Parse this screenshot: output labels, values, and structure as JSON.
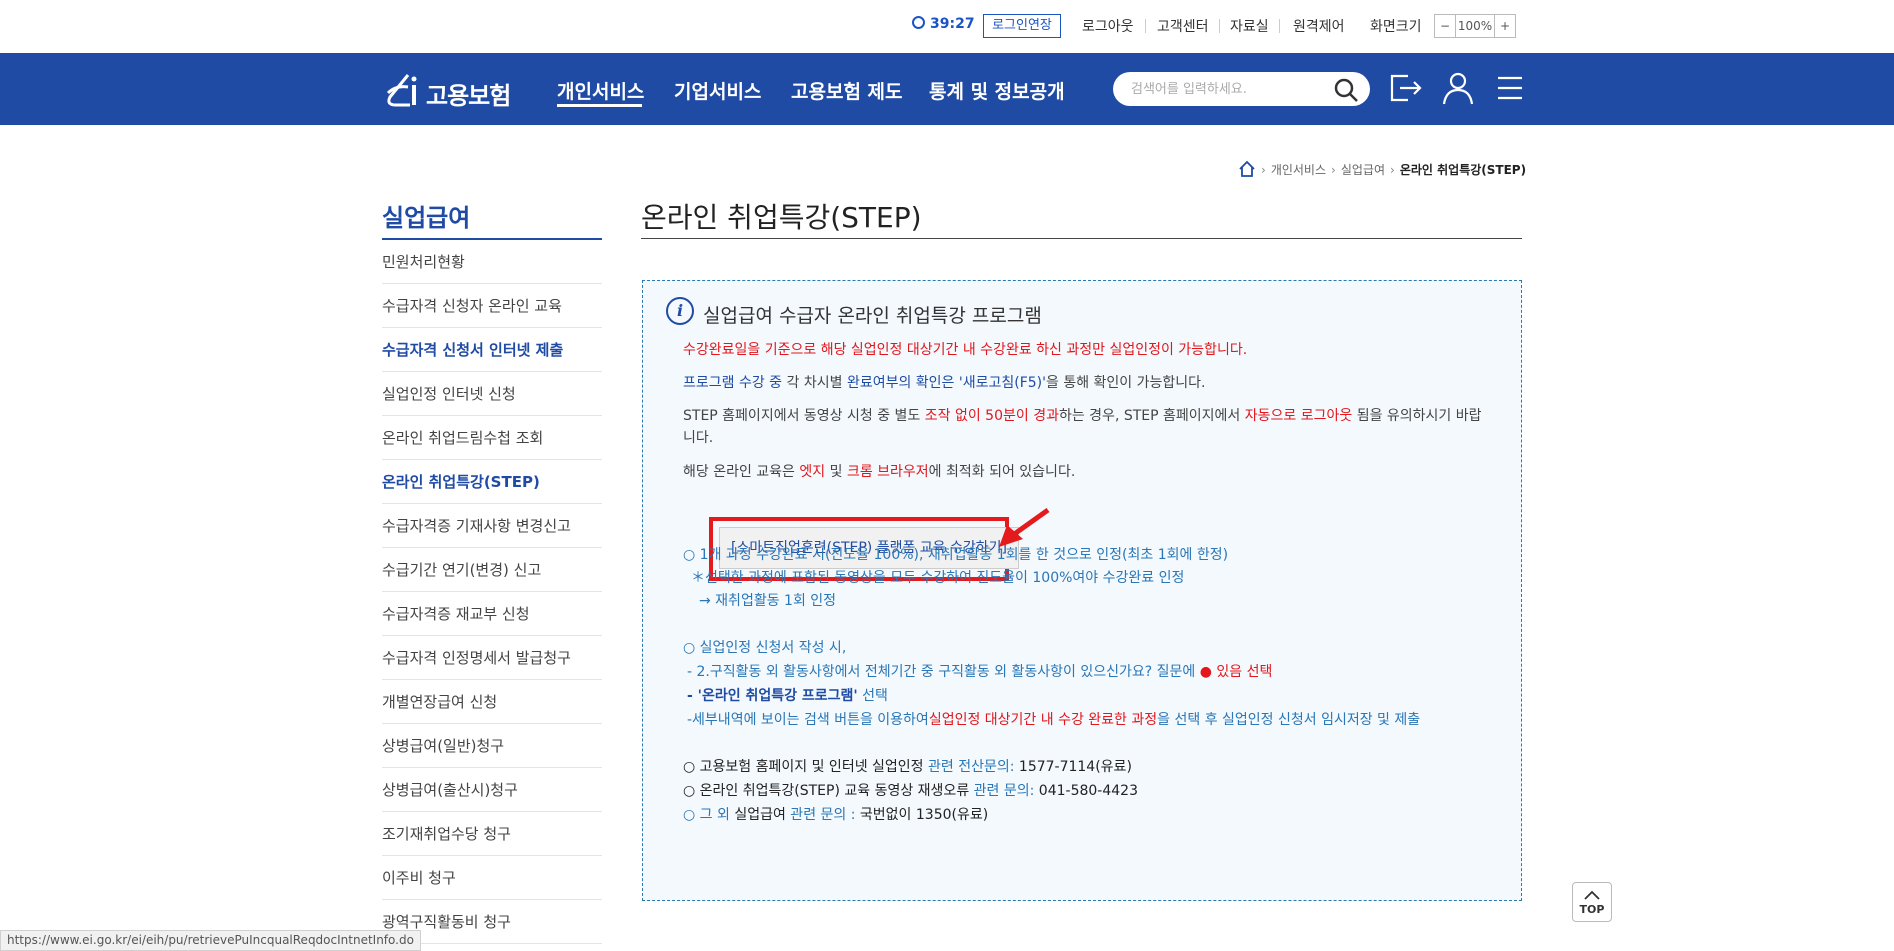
{
  "util_bar": {
    "timer": "39:27",
    "extend_label": "로그인연장",
    "logout": "로그아웃",
    "customer_center": "고객센터",
    "library": "자료실",
    "remote_control": "원격제어",
    "screen_size": "화면크기",
    "zoom_minus": "−",
    "zoom_value": "100%",
    "zoom_plus": "+"
  },
  "nav": {
    "logo_text": "고용보험",
    "items": [
      "개인서비스",
      "기업서비스",
      "고용보험 제도",
      "통계 및 정보공개"
    ],
    "active_index": 0,
    "search_placeholder": "검색어를 입력하세요."
  },
  "breadcrumb": [
    "개인서비스",
    "실업급여",
    "온라인 취업특강(STEP)"
  ],
  "sidebar": {
    "title": "실업급여",
    "items": [
      {
        "label": "민원처리현황"
      },
      {
        "label": "수급자격 신청자 온라인 교육"
      },
      {
        "label": "수급자격 신청서 인터넷 제출"
      },
      {
        "label": "실업인정 인터넷 신청"
      },
      {
        "label": "온라인 취업드림수첩 조회"
      },
      {
        "label": "온라인 취업특강(STEP)"
      },
      {
        "label": "수급자격증 기재사항 변경신고"
      },
      {
        "label": "수급기간 연기(변경) 신고"
      },
      {
        "label": "수급자격증 재교부 신청"
      },
      {
        "label": "수급자격 인정명세서 발급청구"
      },
      {
        "label": "개별연장급여 신청"
      },
      {
        "label": "상병급여(일반)청구"
      },
      {
        "label": "상병급여(출산시)청구"
      },
      {
        "label": "조기재취업수당 청구"
      },
      {
        "label": "이주비 청구"
      },
      {
        "label": "광역구직활동비 청구"
      }
    ]
  },
  "main": {
    "title": "온라인 취업특강(STEP)",
    "box_title": "실업급여 수급자 온라인 취업특강 프로그램",
    "p1": "수강완료일을 기준으로 해당 실업인정 대상기간 내 수강완료 하신 과정만 실업인정이 가능합니다.",
    "p2_a": "프로그램 수강 중",
    "p2_b": " 각 차시별 ",
    "p2_c": "완료여부의 확인은 '새로고침(F5)'",
    "p2_d": "을 통해 확인이 가능합니다.",
    "p3_a": "STEP 홈페이지에서 동영상 시청 중 별도 ",
    "p3_b": "조작 없이 50분이 경과",
    "p3_c": "하는 경우, STEP 홈페이지에서 ",
    "p3_d": "자동으로 로그아웃",
    "p3_e": " 됨을 유의하시기 바랍니다.",
    "p4_a": "해당 온라인 교육은 ",
    "p4_b": "엣지",
    "p4_c": " 및 ",
    "p4_d": "크롬 브라우저",
    "p4_e": "에 최적화 되어 있습니다.",
    "step_button": "[스마트직업훈련(STEP) 플랫폼 교육 수강하기]",
    "n1": "○ 1개 과정 수강완료 시(진도율 100%), 재취업활동 1회를 한 것으로 인정(최초 1회에 한정)",
    "n2": "＊선택한 과정에 포함된 동영상을 모두 수강하여 진도율이 100%여야 수강완료 인정",
    "n3": "→ 재취업활동 1회 인정",
    "m1": "○ 실업인정 신청서 작성 시,",
    "m2_a": "- 2.구직활동 외 활동사항에서 전체기간 중 구직활동 외 활동사항이 있으신가요? 질문에 ",
    "m2_dot": "●",
    "m2_b": " 있음 선택",
    "m3_a": "- '온라인 취업특강 프로그램'",
    "m3_b": " 선택",
    "m4_a": "-세부내역에 보이는 검색 버튼을 이용하여",
    "m4_b": "실업인정 대상기간 내 수강 완료한 과정",
    "m4_c": "을 선택 후 실업인정 신청서 임시저장 및 제출",
    "c1_a": "○ 고용보험 홈페이지 및 인터넷 실업인정",
    "c1_b": " 관련 전산문의: ",
    "c1_c": "1577-7114(유료)",
    "c2_a": "○ 온라인 취업특강(STEP) 교육 동영상 재생오류",
    "c2_b": " 관련 문의: ",
    "c2_c": "041-580-4423",
    "c3_a": "○ 그 외 ",
    "c3_b": "실업급여",
    "c3_c": " 관련 문의 : ",
    "c3_d": "국번없이 1350(유료)"
  },
  "top_button": "TOP",
  "status_url": "https://www.ei.go.kr/ei/eih/pu/retrievePuIncqualReqdocIntnetInfo.do",
  "colors": {
    "nav_bg": "#1f4ba5",
    "accent_red": "#e2161c",
    "box_bg": "#f3f9fd"
  }
}
